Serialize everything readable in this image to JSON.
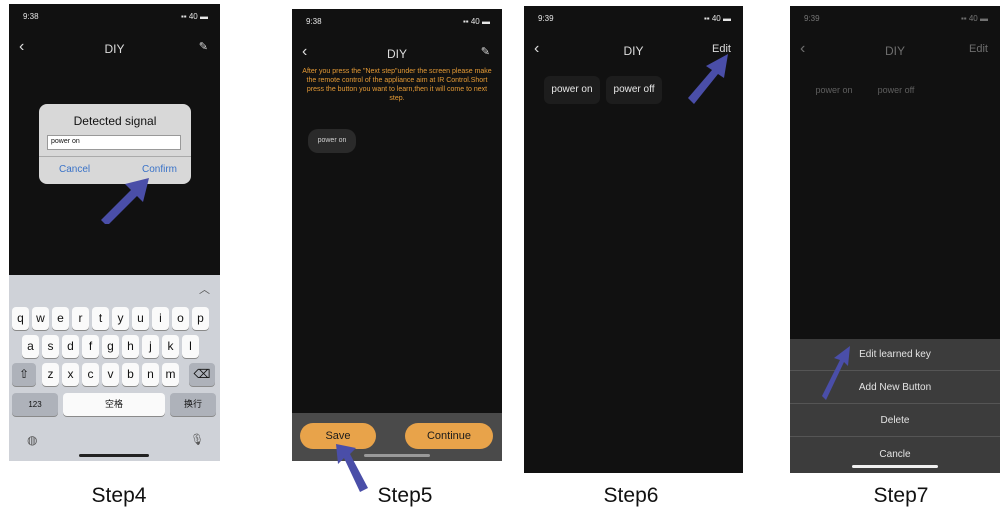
{
  "step4": {
    "label": "Step4",
    "status_time": "9:38",
    "status_signal": "40",
    "nav_title": "DIY",
    "dialog_title": "Detected signal",
    "dialog_input": "power on",
    "cancel_label": "Cancel",
    "confirm_label": "Confirm",
    "keyboard": {
      "row1": [
        "q",
        "w",
        "e",
        "r",
        "t",
        "y",
        "u",
        "i",
        "o",
        "p"
      ],
      "row2": [
        "a",
        "s",
        "d",
        "f",
        "g",
        "h",
        "j",
        "k",
        "l"
      ],
      "row3": [
        "z",
        "x",
        "c",
        "v",
        "b",
        "n",
        "m"
      ],
      "num_key": "123",
      "space_key": "空格",
      "return_key": "换行"
    }
  },
  "step5": {
    "label": "Step5",
    "status_time": "9:38",
    "status_signal": "40",
    "nav_title": "DIY",
    "instruction": "After you press the \"Next step\"under the screen please make the remote control of the appliance aim at IR Control.Short press the button you want to learn,then it will come to next step.",
    "chip": "power on",
    "save_label": "Save",
    "continue_label": "Continue"
  },
  "step6": {
    "label": "Step6",
    "status_time": "9:39",
    "status_signal": "40",
    "nav_title": "DIY",
    "edit_label": "Edit",
    "button_on": "power on",
    "button_off": "power off"
  },
  "step7": {
    "label": "Step7",
    "status_time": "9:39",
    "status_signal": "40",
    "nav_title": "DIY",
    "edit_label": "Edit",
    "button_on": "power on",
    "button_off": "power off",
    "options": [
      "Edit learned key",
      "Add New Button",
      "Delete"
    ],
    "cancel_label": "Cancle"
  },
  "colors": {
    "phone_bg": "#111111",
    "accent_orange": "#e8a34a",
    "instruction_orange": "#e59a35",
    "dialog_link_blue": "#3a73c8",
    "arrow_blue": "#4a4ea8"
  }
}
